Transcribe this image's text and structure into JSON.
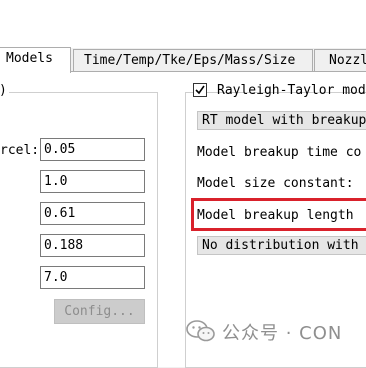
{
  "tabs": [
    {
      "label": "Models",
      "active": true
    },
    {
      "label": "Time/Temp/Tke/Eps/Mass/Size",
      "active": false
    },
    {
      "label": "Nozzl",
      "active": false
    }
  ],
  "left_group": {
    "caption_fragment": ")",
    "label_fragment": "rcel:",
    "fields": [
      "0.05",
      "1.0",
      "0.61",
      "0.188",
      "7.0"
    ],
    "config_button": "Config..."
  },
  "right_group": {
    "checkbox_label": "Rayleigh-Taylor mod",
    "checkbox_checked": true,
    "rt_dropdown": "RT model with breakup",
    "breakup_time_label": "Model breakup time co",
    "size_constant_label": "Model size constant:",
    "breakup_length_label": "Model breakup length",
    "distribution_dropdown": "No distribution with"
  },
  "watermark": {
    "text": "公众号 · CON",
    "icon": "wechat-icon"
  },
  "colors": {
    "highlight": "#d9212b",
    "panel": "#ffffff",
    "chrome": "#f0f0f0"
  }
}
